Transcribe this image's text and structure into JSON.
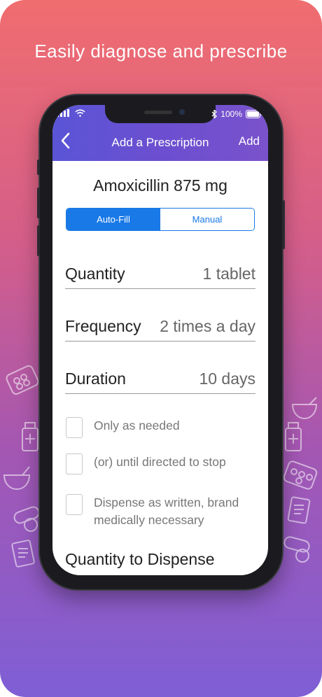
{
  "promo": {
    "headline": "Easily diagnose and prescribe"
  },
  "status_bar": {
    "battery": "100%"
  },
  "nav": {
    "title": "Add a Prescription",
    "add_label": "Add"
  },
  "drug": {
    "name": "Amoxicillin 875 mg"
  },
  "segment": {
    "options": [
      "Auto-Fill",
      "Manual"
    ],
    "selected": "Auto-Fill"
  },
  "fields": [
    {
      "label": "Quantity",
      "value": "1 tablet"
    },
    {
      "label": "Frequency",
      "value": "2 times a day"
    },
    {
      "label": "Duration",
      "value": "10 days"
    }
  ],
  "checkboxes": [
    {
      "label": "Only as needed",
      "checked": false
    },
    {
      "label": "(or) until directed to stop",
      "checked": false
    },
    {
      "label": "Dispense as written, brand medically necessary",
      "checked": false
    }
  ],
  "section": {
    "title": "Quantity to Dispense"
  },
  "colors": {
    "accent": "#1979e6",
    "nav_start": "#5a55d6",
    "nav_end": "#7a52cc"
  }
}
